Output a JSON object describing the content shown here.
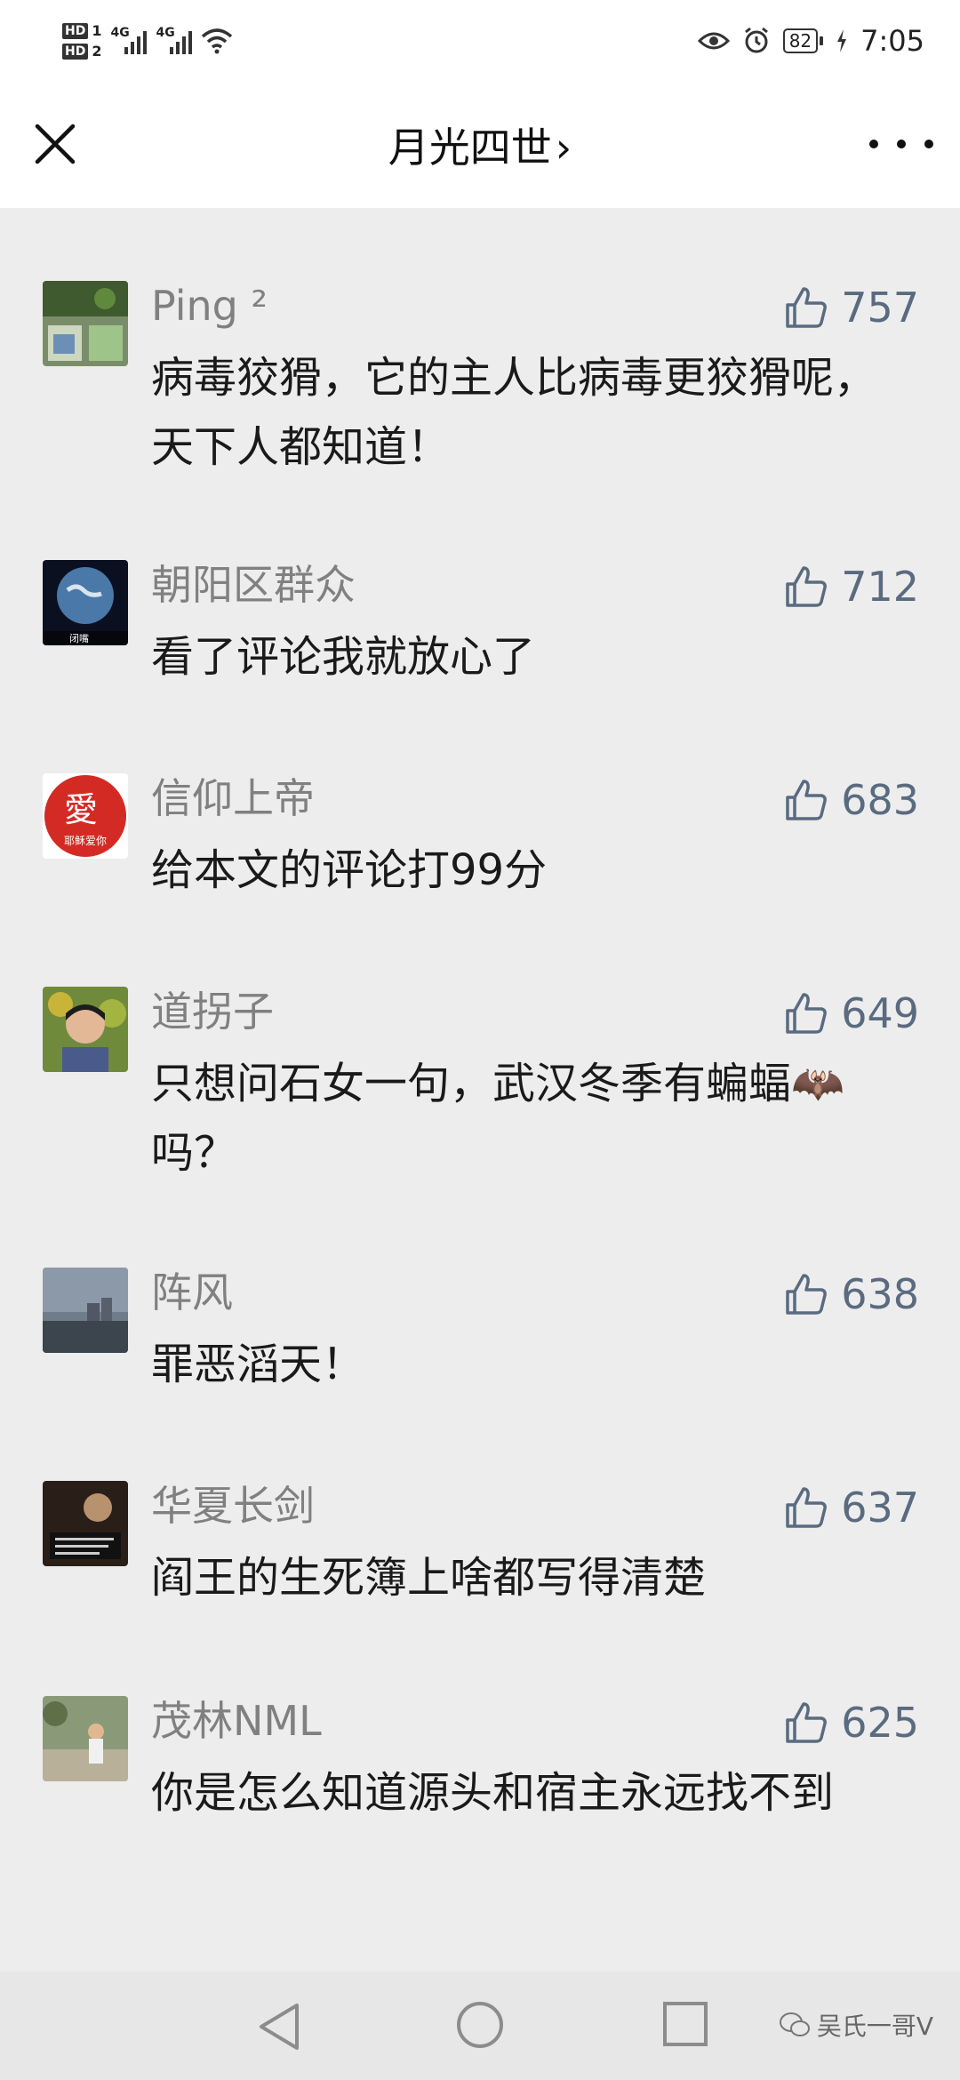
{
  "status_bar": {
    "hd1": "HD",
    "hd1_sub": "1",
    "hd2": "HD",
    "hd2_sub": "2",
    "net1": "4G",
    "net2": "4G",
    "battery": "82",
    "time": "7:05"
  },
  "header": {
    "title": "月光四世",
    "chevron": "›"
  },
  "comments": [
    {
      "name": "Ping ²",
      "likes": "757",
      "text": "病毒狡猾，它的主人比病毒更狡猾呢，天下人都知道！"
    },
    {
      "name": "朝阳区群众",
      "likes": "712",
      "text": "看了评论我就放心了",
      "avatar_text": "闭嘴"
    },
    {
      "name": "信仰上帝",
      "likes": "683",
      "text": "给本文的评论打99分",
      "avatar_text": "愛",
      "avatar_sub": "耶稣爱你"
    },
    {
      "name": "道拐子",
      "likes": "649",
      "text": "只想问石女一句，武汉冬季有蝙蝠🦇 吗？"
    },
    {
      "name": "阵风",
      "likes": "638",
      "text": "罪恶滔天！"
    },
    {
      "name": "华夏长剑",
      "likes": "637",
      "text": "阎王的生死簿上啥都写得清楚"
    },
    {
      "name": "茂林NML",
      "likes": "625",
      "text": "你是怎么知道源头和宿主永远找不到"
    }
  ],
  "watermark": "吴氏一哥V",
  "colors": {
    "background": "#ededed",
    "name": "#808080",
    "likes": "#5a6b80",
    "text": "#1a1a1a"
  }
}
